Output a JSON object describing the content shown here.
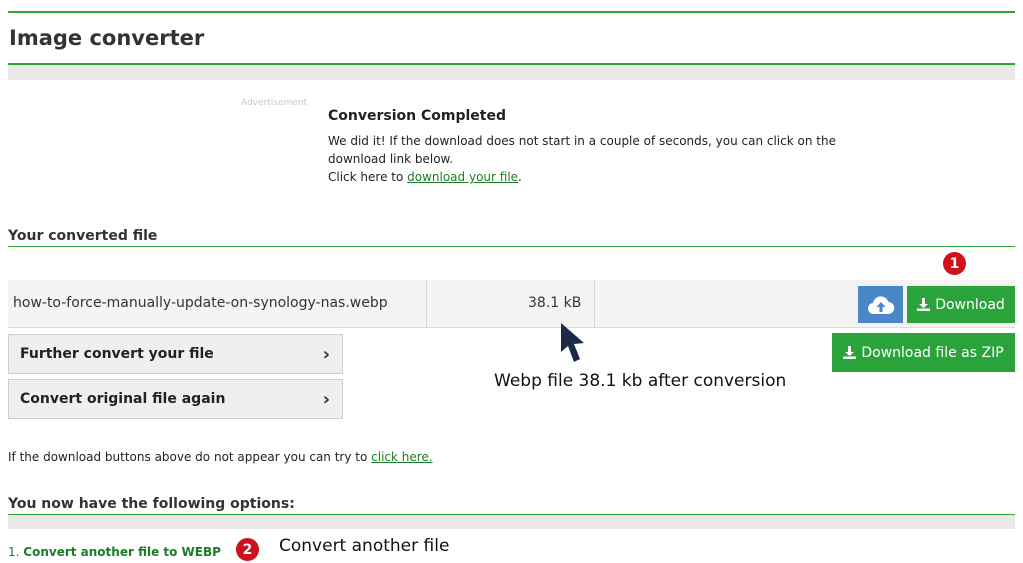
{
  "header": {
    "title": "Image converter"
  },
  "ad": {
    "label": "Advertisement"
  },
  "conversion": {
    "title": "Conversion Completed",
    "line1": "We did it! If the download does not start in a couple of seconds, you can click on the",
    "line2": "download link below.",
    "line3_prefix": "Click here to ",
    "line3_link": "download your file",
    "line3_suffix": "."
  },
  "converted_section": {
    "heading": "Your converted file"
  },
  "file": {
    "name": "how-to-force-manually-update-on-synology-nas.webp",
    "size": "38.1 kB"
  },
  "buttons": {
    "download": "Download",
    "download_zip": "Download file as ZIP",
    "further_convert": "Further convert your file",
    "convert_again": "Convert original file again",
    "cloud_icon": "cloud-upload-icon",
    "download_icon": "download-icon",
    "chevron_icon": "chevron-right-icon"
  },
  "annotations": {
    "badge1": "1",
    "badge2": "2",
    "arrow_note": "Webp file 38.1 kb after conversion",
    "convert_note": "Convert another file"
  },
  "hint": {
    "prefix": "If the download buttons above do not appear you can try to ",
    "link": "click here."
  },
  "options": {
    "heading": "You now have the following options:",
    "items": [
      {
        "number": "1.",
        "label": "Convert another file to WEBP"
      }
    ]
  },
  "colors": {
    "accent": "#2aa33a",
    "cloud_button": "#4a86c8",
    "badge": "#d0101a",
    "link": "#1a7d25"
  }
}
